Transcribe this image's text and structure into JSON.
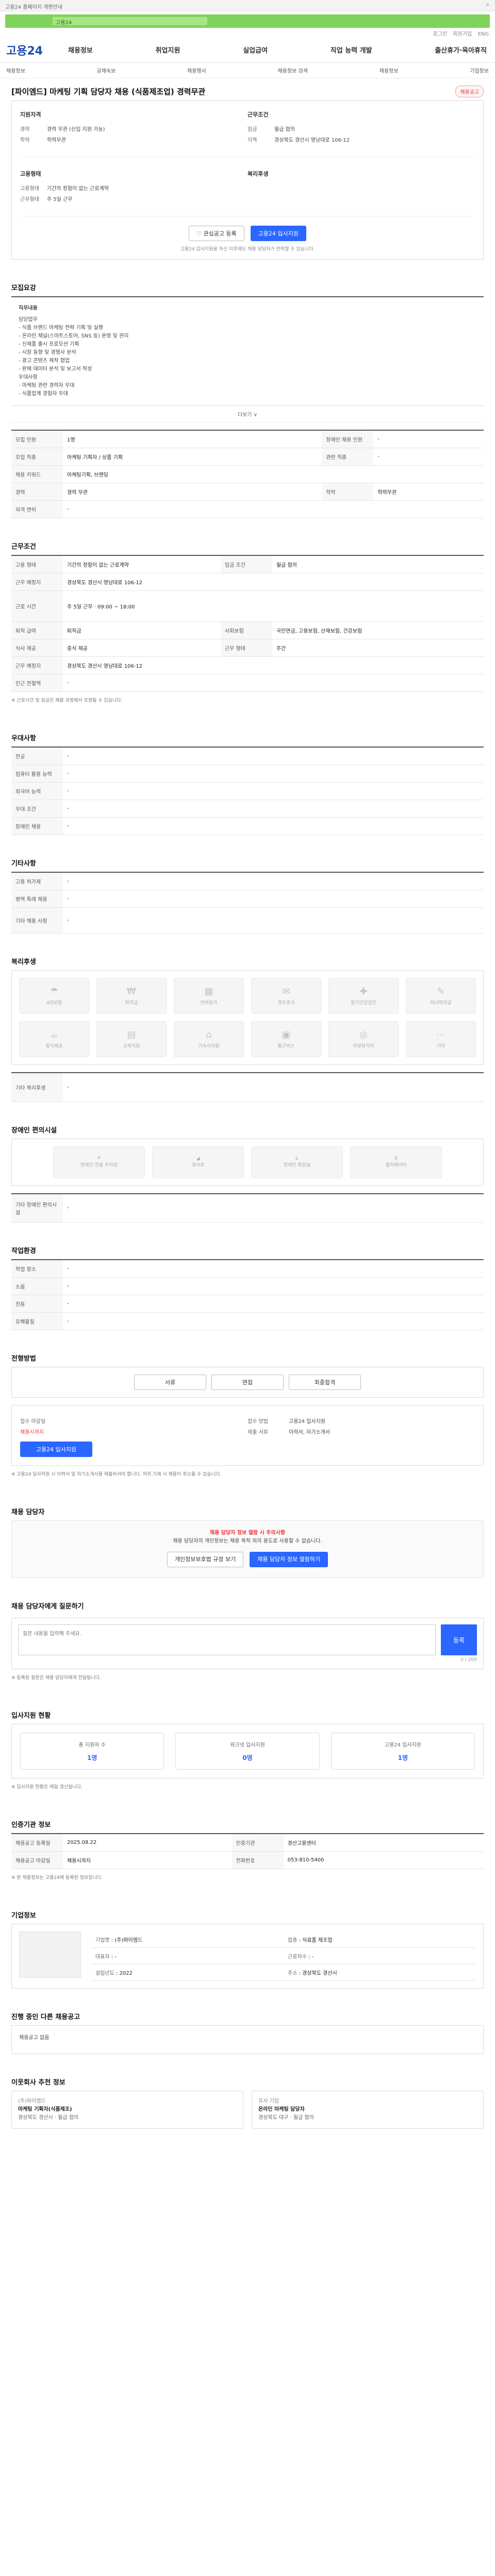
{
  "topbar": {
    "text": "고용24 홈페이지 개편안내",
    "close": "×"
  },
  "banner": {
    "text": "고용24"
  },
  "util": [
    "로그인",
    "회원가입",
    "ENG"
  ],
  "gnb": {
    "logo": "고용24",
    "menu": [
      "채용정보",
      "취업지원",
      "실업급여",
      "직업 능력 개발",
      "출산휴가·육아휴직"
    ]
  },
  "subnav": {
    "items": [
      "채용정보",
      "공채속보",
      "채용행사",
      "채용정보 검색",
      "채용정보",
      "기업정보"
    ]
  },
  "job": {
    "title": "[파이엠드] 마케팅 기획 담당자 채용 (식품제조업) 경력무관",
    "badge": "채용공고",
    "left_h": "지원자격",
    "right_h": "근무조건",
    "left": [
      [
        "경력",
        "경력 무관 (신입 지원 가능)"
      ],
      [
        "학력",
        "학력무관"
      ]
    ],
    "right": [
      [
        "임금",
        "월급 협의"
      ],
      [
        "지역",
        "경상북도 경산시 영남대로 106-12"
      ]
    ],
    "left2_h": "고용형태",
    "left2": [
      [
        "고용형태",
        "기간의 정함이 없는 근로계약"
      ],
      [
        "근무형태",
        "주 5일 근무"
      ]
    ],
    "right2_h": "복리후생",
    "btn_scrap": "관심공고 등록",
    "btn_apply": "고용24 입사지원",
    "note": "고용24 입사지원을 하신 이후에도 채용 담당자가 연락할 수 있습니다."
  },
  "recruit": {
    "title": "모집요강",
    "duty_h": "직무내용",
    "duty": [
      "담당업무",
      "- 식품 브랜드 마케팅 전략 기획 및 실행",
      "- 온라인 채널(스마트스토어, SNS 등) 운영 및 관리",
      "- 신제품 출시 프로모션 기획",
      "- 시장 동향 및 경쟁사 분석",
      "- 광고 콘텐츠 제작 협업",
      "- 판매 데이터 분석 및 보고서 작성",
      "",
      "우대사항",
      "- 마케팅 관련 경력자 우대",
      "- 식품업계 경험자 우대"
    ],
    "more": "더보기 ∨",
    "rows": [
      [
        "모집 인원",
        "1명",
        "장애인 채용 인원",
        "-"
      ],
      [
        "모집 직종",
        "마케팅 기획자 / 상품 기획",
        "관련 직종",
        "-"
      ],
      [
        "채용 키워드",
        "마케팅기획, 브랜딩",
        "",
        ""
      ],
      [
        "경력",
        "경력 무관",
        "학력",
        "학력무관"
      ],
      [
        "자격 면허",
        "-",
        "",
        ""
      ]
    ]
  },
  "work": {
    "title": "근무조건",
    "rows": [
      [
        "고용 형태",
        "기간의 정함이 없는 근로계약",
        "임금 조건",
        "월급 협의"
      ],
      [
        "근무 예정지",
        "경상북도 경산시 영남대로 106-12",
        "",
        ""
      ],
      [
        "근로 시간",
        "주 5일 근무 · 09:00 ~ 18:00",
        "",
        ""
      ],
      [
        "퇴직 급여",
        "퇴직금",
        "사회보험",
        "국민연금, 고용보험, 산재보험, 건강보험"
      ],
      [
        "식사 제공",
        "중식 제공",
        "근무 형태",
        "주간"
      ],
      [
        "근무 예정지",
        "경상북도 경산시 영남대로 106-12",
        "",
        ""
      ],
      [
        "인근 전철역",
        "-",
        "",
        ""
      ]
    ],
    "notice": "※ 근로시간 및 임금은 채용 과정에서 조정될 수 있습니다."
  },
  "prefer": {
    "title": "우대사항",
    "rows": [
      [
        "전공",
        "-"
      ],
      [
        "컴퓨터 활용 능력",
        "-"
      ],
      [
        "외국어 능력",
        "-"
      ],
      [
        "우대 조건",
        "-"
      ],
      [
        "장애인 채용",
        "-"
      ]
    ]
  },
  "etc": {
    "title": "기타사항",
    "rows": [
      [
        "고용 허가제",
        "-"
      ],
      [
        "병역 특례 채용",
        "-"
      ],
      [
        "기타 채용 사항",
        "-"
      ]
    ]
  },
  "benefit": {
    "title": "복리후생",
    "items": [
      "4대보험",
      "퇴직금",
      "연차휴가",
      "경조휴가",
      "정기건강검진",
      "자녀학자금",
      "중식제공",
      "교육지원",
      "기숙사지원",
      "통근버스",
      "차량유지비",
      "기타"
    ],
    "etc_h": "기타 복리후생",
    "etc_v": "-"
  },
  "disability": {
    "title": "장애인 편의시설",
    "items": [
      "장애인 전용 주차장",
      "경사로",
      "장애인 화장실",
      "엘리베이터"
    ],
    "etc_h": "기타 장애인 편의시설",
    "etc_v": "-"
  },
  "env": {
    "title": "작업환경",
    "rows": [
      [
        "작업 장소",
        "-",
        "",
        ""
      ],
      [
        "소음",
        "-",
        "",
        ""
      ],
      [
        "진동",
        "-",
        "",
        ""
      ],
      [
        "유해물질",
        "-",
        "",
        ""
      ]
    ]
  },
  "process": {
    "title": "전형방법",
    "steps": [
      "서류",
      "면접",
      "최종합격"
    ],
    "deadline_h": "접수 마감일",
    "deadline_v": "채용시까지",
    "method_h": "접수 방법",
    "method_v": "고용24 입사지원",
    "docs_h": "제출 서류",
    "docs_v": "이력서, 자기소개서",
    "apply": "고용24 입사지원",
    "info": "※ 고용24 입사지원 시 이력서 및 자기소개서를 제출하셔야 합니다. 허위 기재 시 채용이 취소될 수 있습니다."
  },
  "manager": {
    "title": "채용 담당자",
    "warn_h": "채용 담당자 정보 열람 시 주의사항",
    "warn": "채용 담당자의 개인정보는 채용 목적 외의 용도로 사용할 수 없습니다.",
    "btn1": "개인정보보호법 규정 보기",
    "btn2": "채용 담당자 정보 열람하기"
  },
  "inquiry": {
    "title": "채용 담당자에게 질문하기",
    "placeholder": "질문 내용을 입력해 주세요.",
    "count": "0 / 200",
    "submit": "등록",
    "notes": "※ 등록된 질문은 채용 담당자에게 전달됩니다."
  },
  "status": {
    "title": "입사지원 현황",
    "items": [
      [
        "총 지원자 수",
        "1명"
      ],
      [
        "워크넷 입사지원",
        "0명"
      ],
      [
        "고용24 입사지원",
        "1명"
      ]
    ],
    "note": "※ 입사지원 현황은 매일 갱신됩니다."
  },
  "regi": {
    "title": "인증기관 정보",
    "rows": [
      [
        "채용공고 등록일",
        "2025.08.22",
        "인증기관",
        "경산고용센터"
      ],
      [
        "채용공고 마감일",
        "채용시까지",
        "전화번호",
        "053-810-5400"
      ]
    ],
    "note": "※ 본 채용정보는 고용24에 등록된 정보입니다."
  },
  "company": {
    "title": "기업정보",
    "rows": [
      [
        "기업명",
        "(주)파이엠드"
      ],
      [
        "업종",
        "식료품 제조업"
      ],
      [
        "대표자",
        "-"
      ],
      [
        "근로자수",
        "-"
      ],
      [
        "설립년도",
        "2022"
      ],
      [
        "주소",
        "경상북도 경산시"
      ]
    ]
  },
  "related": {
    "title": "진행 중인 다른 채용공고",
    "name": "채용공고 없음"
  },
  "recommend": {
    "title": "이웃회사 추천 정보",
    "cards": [
      [
        "(주)파이엠드",
        "마케팅 기획자(식품제조)",
        "경상북도 경산시 · 월급 협의"
      ],
      [
        "유사 기업",
        "온라인 마케팅 담당자",
        "경상북도 대구 · 월급 협의"
      ]
    ]
  }
}
